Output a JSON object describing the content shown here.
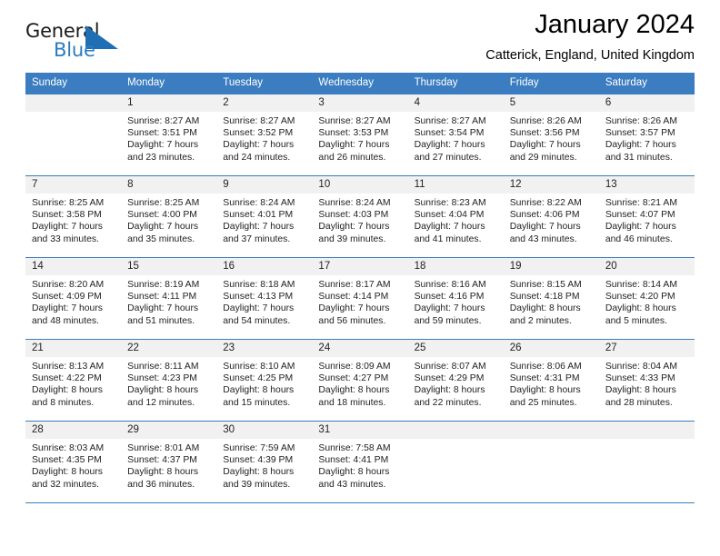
{
  "brand": {
    "name_part1": "General",
    "name_part2": "Blue",
    "logo_icon": "triangle-logo-icon",
    "accent_color": "#2b7cc0"
  },
  "header": {
    "title": "January 2024",
    "subtitle": "Catterick, England, United Kingdom"
  },
  "calendar": {
    "header_bg": "#3b7dc0",
    "daynum_bg": "#f1f1f1",
    "weekdays": [
      "Sunday",
      "Monday",
      "Tuesday",
      "Wednesday",
      "Thursday",
      "Friday",
      "Saturday"
    ],
    "weeks": [
      [
        {
          "day": "",
          "lines": []
        },
        {
          "day": "1",
          "lines": [
            "Sunrise: 8:27 AM",
            "Sunset: 3:51 PM",
            "Daylight: 7 hours",
            "and 23 minutes."
          ]
        },
        {
          "day": "2",
          "lines": [
            "Sunrise: 8:27 AM",
            "Sunset: 3:52 PM",
            "Daylight: 7 hours",
            "and 24 minutes."
          ]
        },
        {
          "day": "3",
          "lines": [
            "Sunrise: 8:27 AM",
            "Sunset: 3:53 PM",
            "Daylight: 7 hours",
            "and 26 minutes."
          ]
        },
        {
          "day": "4",
          "lines": [
            "Sunrise: 8:27 AM",
            "Sunset: 3:54 PM",
            "Daylight: 7 hours",
            "and 27 minutes."
          ]
        },
        {
          "day": "5",
          "lines": [
            "Sunrise: 8:26 AM",
            "Sunset: 3:56 PM",
            "Daylight: 7 hours",
            "and 29 minutes."
          ]
        },
        {
          "day": "6",
          "lines": [
            "Sunrise: 8:26 AM",
            "Sunset: 3:57 PM",
            "Daylight: 7 hours",
            "and 31 minutes."
          ]
        }
      ],
      [
        {
          "day": "7",
          "lines": [
            "Sunrise: 8:25 AM",
            "Sunset: 3:58 PM",
            "Daylight: 7 hours",
            "and 33 minutes."
          ]
        },
        {
          "day": "8",
          "lines": [
            "Sunrise: 8:25 AM",
            "Sunset: 4:00 PM",
            "Daylight: 7 hours",
            "and 35 minutes."
          ]
        },
        {
          "day": "9",
          "lines": [
            "Sunrise: 8:24 AM",
            "Sunset: 4:01 PM",
            "Daylight: 7 hours",
            "and 37 minutes."
          ]
        },
        {
          "day": "10",
          "lines": [
            "Sunrise: 8:24 AM",
            "Sunset: 4:03 PM",
            "Daylight: 7 hours",
            "and 39 minutes."
          ]
        },
        {
          "day": "11",
          "lines": [
            "Sunrise: 8:23 AM",
            "Sunset: 4:04 PM",
            "Daylight: 7 hours",
            "and 41 minutes."
          ]
        },
        {
          "day": "12",
          "lines": [
            "Sunrise: 8:22 AM",
            "Sunset: 4:06 PM",
            "Daylight: 7 hours",
            "and 43 minutes."
          ]
        },
        {
          "day": "13",
          "lines": [
            "Sunrise: 8:21 AM",
            "Sunset: 4:07 PM",
            "Daylight: 7 hours",
            "and 46 minutes."
          ]
        }
      ],
      [
        {
          "day": "14",
          "lines": [
            "Sunrise: 8:20 AM",
            "Sunset: 4:09 PM",
            "Daylight: 7 hours",
            "and 48 minutes."
          ]
        },
        {
          "day": "15",
          "lines": [
            "Sunrise: 8:19 AM",
            "Sunset: 4:11 PM",
            "Daylight: 7 hours",
            "and 51 minutes."
          ]
        },
        {
          "day": "16",
          "lines": [
            "Sunrise: 8:18 AM",
            "Sunset: 4:13 PM",
            "Daylight: 7 hours",
            "and 54 minutes."
          ]
        },
        {
          "day": "17",
          "lines": [
            "Sunrise: 8:17 AM",
            "Sunset: 4:14 PM",
            "Daylight: 7 hours",
            "and 56 minutes."
          ]
        },
        {
          "day": "18",
          "lines": [
            "Sunrise: 8:16 AM",
            "Sunset: 4:16 PM",
            "Daylight: 7 hours",
            "and 59 minutes."
          ]
        },
        {
          "day": "19",
          "lines": [
            "Sunrise: 8:15 AM",
            "Sunset: 4:18 PM",
            "Daylight: 8 hours",
            "and 2 minutes."
          ]
        },
        {
          "day": "20",
          "lines": [
            "Sunrise: 8:14 AM",
            "Sunset: 4:20 PM",
            "Daylight: 8 hours",
            "and 5 minutes."
          ]
        }
      ],
      [
        {
          "day": "21",
          "lines": [
            "Sunrise: 8:13 AM",
            "Sunset: 4:22 PM",
            "Daylight: 8 hours",
            "and 8 minutes."
          ]
        },
        {
          "day": "22",
          "lines": [
            "Sunrise: 8:11 AM",
            "Sunset: 4:23 PM",
            "Daylight: 8 hours",
            "and 12 minutes."
          ]
        },
        {
          "day": "23",
          "lines": [
            "Sunrise: 8:10 AM",
            "Sunset: 4:25 PM",
            "Daylight: 8 hours",
            "and 15 minutes."
          ]
        },
        {
          "day": "24",
          "lines": [
            "Sunrise: 8:09 AM",
            "Sunset: 4:27 PM",
            "Daylight: 8 hours",
            "and 18 minutes."
          ]
        },
        {
          "day": "25",
          "lines": [
            "Sunrise: 8:07 AM",
            "Sunset: 4:29 PM",
            "Daylight: 8 hours",
            "and 22 minutes."
          ]
        },
        {
          "day": "26",
          "lines": [
            "Sunrise: 8:06 AM",
            "Sunset: 4:31 PM",
            "Daylight: 8 hours",
            "and 25 minutes."
          ]
        },
        {
          "day": "27",
          "lines": [
            "Sunrise: 8:04 AM",
            "Sunset: 4:33 PM",
            "Daylight: 8 hours",
            "and 28 minutes."
          ]
        }
      ],
      [
        {
          "day": "28",
          "lines": [
            "Sunrise: 8:03 AM",
            "Sunset: 4:35 PM",
            "Daylight: 8 hours",
            "and 32 minutes."
          ]
        },
        {
          "day": "29",
          "lines": [
            "Sunrise: 8:01 AM",
            "Sunset: 4:37 PM",
            "Daylight: 8 hours",
            "and 36 minutes."
          ]
        },
        {
          "day": "30",
          "lines": [
            "Sunrise: 7:59 AM",
            "Sunset: 4:39 PM",
            "Daylight: 8 hours",
            "and 39 minutes."
          ]
        },
        {
          "day": "31",
          "lines": [
            "Sunrise: 7:58 AM",
            "Sunset: 4:41 PM",
            "Daylight: 8 hours",
            "and 43 minutes."
          ]
        },
        {
          "day": "",
          "lines": []
        },
        {
          "day": "",
          "lines": []
        },
        {
          "day": "",
          "lines": []
        }
      ]
    ]
  }
}
